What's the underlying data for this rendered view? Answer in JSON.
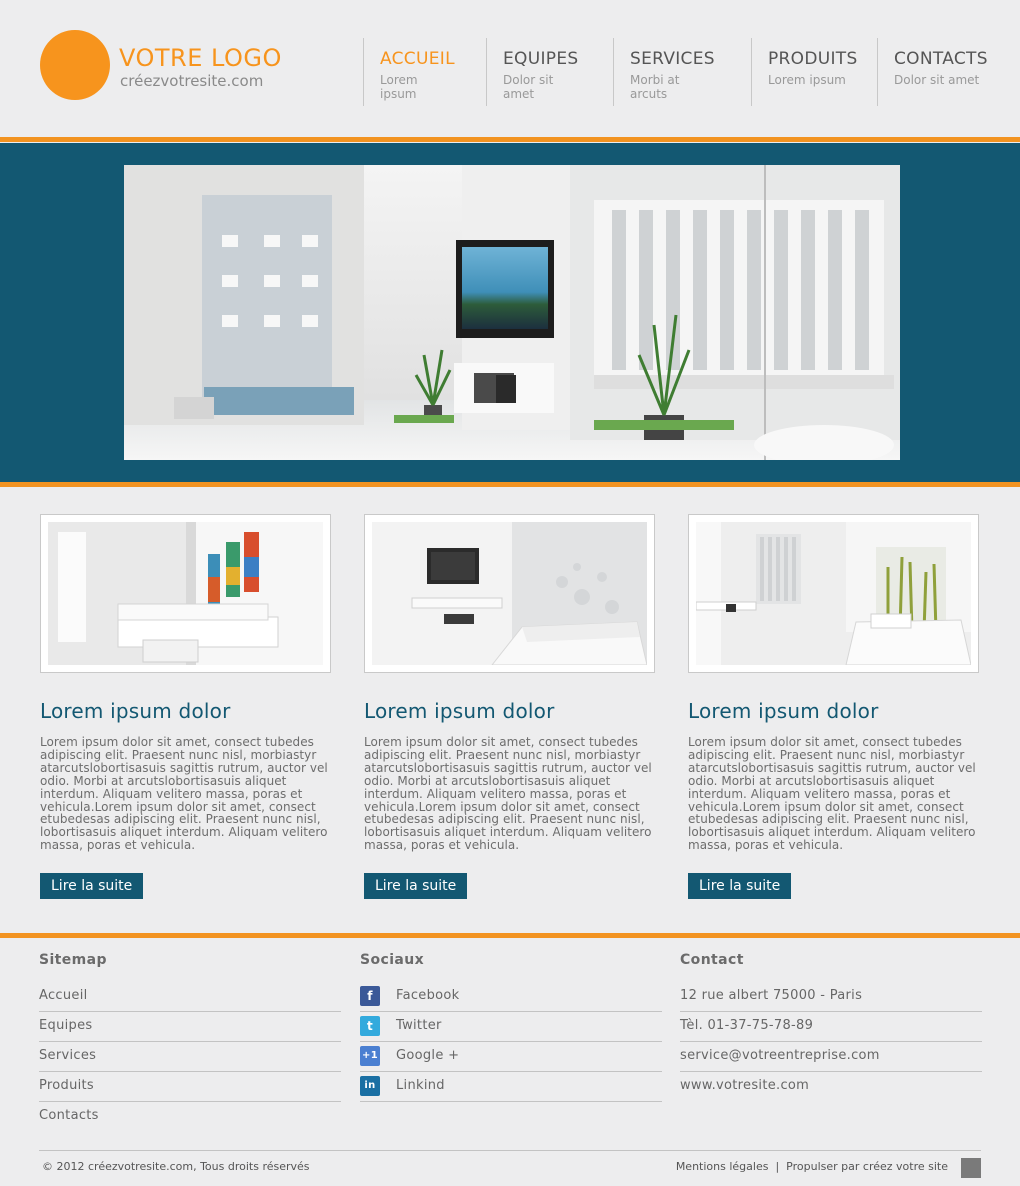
{
  "logo": {
    "title": "VOTRE LOGO",
    "subtitle": "créezvotresite.com"
  },
  "nav": [
    {
      "title": "ACCUEIL",
      "sub": "Lorem ipsum"
    },
    {
      "title": "EQUIPES",
      "sub": "Dolor sit amet"
    },
    {
      "title": "SERVICES",
      "sub": "Morbi at arcuts"
    },
    {
      "title": "PRODUITS",
      "sub": "Lorem ipsum"
    },
    {
      "title": "CONTACTS",
      "sub": "Dolor sit amet"
    }
  ],
  "colors": {
    "accent": "#f7941d",
    "brand": "#135872",
    "background": "#ededee"
  },
  "columns": [
    {
      "title": "Lorem ipsum dolor",
      "text": "Lorem ipsum dolor sit amet, consect tubedes adipiscing elit. Praesent nunc nisl, morbiastyr atarcutslobortisasuis sagittis rutrum, auctor vel odio. Morbi at arcutslobortisasuis  aliquet interdum. Aliquam velitero massa, poras et vehicula.Lorem ipsum dolor sit amet, consect etubedesas adipiscing elit. Praesent nunc nisl, lobortisasuis  aliquet interdum. Aliquam velitero massa, poras et vehicula.",
      "button": "Lire la suite"
    },
    {
      "title": "Lorem ipsum dolor",
      "text": "Lorem ipsum dolor sit amet, consect tubedes adipiscing elit. Praesent nunc nisl, morbiastyr atarcutslobortisasuis sagittis rutrum, auctor vel odio. Morbi at arcutslobortisasuis  aliquet interdum. Aliquam velitero massa, poras et vehicula.Lorem ipsum dolor sit amet, consect etubedesas adipiscing elit. Praesent nunc nisl, lobortisasuis  aliquet interdum. Aliquam velitero massa, poras et vehicula.",
      "button": "Lire la suite"
    },
    {
      "title": "Lorem ipsum dolor",
      "text": "Lorem ipsum dolor sit amet, consect tubedes adipiscing elit. Praesent nunc nisl, morbiastyr atarcutslobortisasuis sagittis rutrum, auctor vel odio. Morbi at arcutslobortisasuis  aliquet interdum. Aliquam velitero massa, poras et vehicula.Lorem ipsum dolor sit amet, consect etubedesas adipiscing elit. Praesent nunc nisl, lobortisasuis  aliquet interdum. Aliquam velitero massa, poras et vehicula.",
      "button": "Lire la suite"
    }
  ],
  "footer": {
    "sitemap": {
      "title": "Sitemap",
      "items": [
        "Accueil",
        "Equipes",
        "Services",
        "Produits",
        "Contacts"
      ]
    },
    "social": {
      "title": "Sociaux",
      "items": [
        {
          "label": "Facebook",
          "icon": "facebook-icon",
          "glyph": "f",
          "color": "#3b5998"
        },
        {
          "label": "Twitter",
          "icon": "twitter-icon",
          "glyph": "t",
          "color": "#33aadd"
        },
        {
          "label": "Google +",
          "icon": "google-plus-icon",
          "glyph": "+1",
          "color": "#4a7fd1"
        },
        {
          "label": "Linkind",
          "icon": "linkedin-icon",
          "glyph": "in",
          "color": "#1a6fa3"
        }
      ]
    },
    "contact": {
      "title": "Contact",
      "items": [
        "12 rue albert 75000 - Paris",
        "Tèl. 01-37-75-78-89",
        "service@votreentreprise.com",
        "www.votresite.com"
      ]
    },
    "copyright": "© 2012 créezvotresite.com, Tous droits réservés",
    "legal": "Mentions légales",
    "separator": "|",
    "powered": "Propulser par créez votre site"
  }
}
